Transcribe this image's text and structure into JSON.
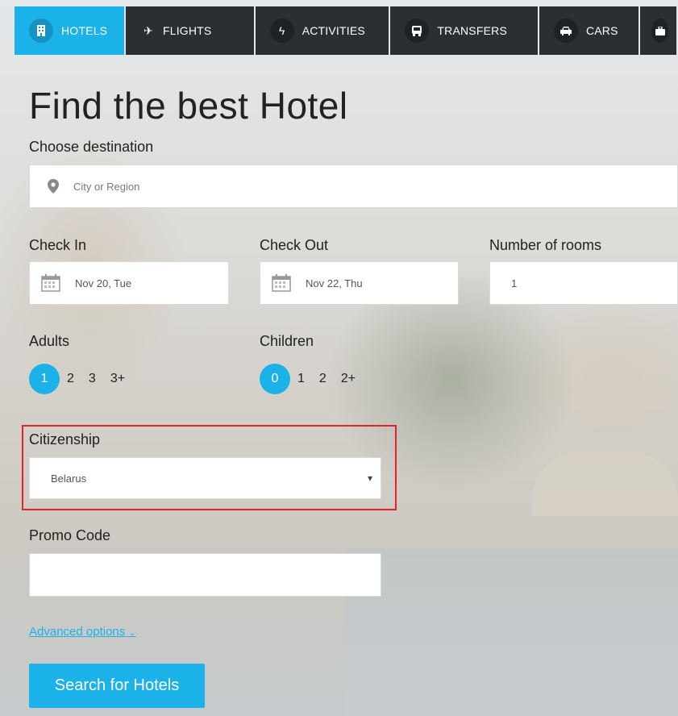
{
  "tabs": [
    {
      "label": "HOTELS",
      "icon": "hotel-icon"
    },
    {
      "label": "FLIGHTS",
      "icon": "plane-icon"
    },
    {
      "label": "ACTIVITIES",
      "icon": "bolt-icon"
    },
    {
      "label": "TRANSFERS",
      "icon": "bus-icon"
    },
    {
      "label": "CARS",
      "icon": "car-icon"
    },
    {
      "label": "",
      "icon": "briefcase-icon"
    }
  ],
  "page": {
    "title": "Find the best Hotel"
  },
  "destination": {
    "label": "Choose destination",
    "placeholder": "City or Region",
    "value": ""
  },
  "check_in": {
    "label": "Check In",
    "value": "Nov 20, Tue"
  },
  "check_out": {
    "label": "Check Out",
    "value": "Nov 22, Thu"
  },
  "rooms": {
    "label": "Number of rooms",
    "value": "1"
  },
  "adults": {
    "label": "Adults",
    "options": [
      "1",
      "2",
      "3",
      "3+"
    ],
    "selected": "1"
  },
  "children": {
    "label": "Children",
    "options": [
      "0",
      "1",
      "2",
      "2+"
    ],
    "selected": "0"
  },
  "citizenship": {
    "label": "Citizenship",
    "value": "Belarus",
    "arrow": "▾"
  },
  "promo": {
    "label": "Promo Code",
    "value": ""
  },
  "advanced": {
    "label": "Advanced options",
    "chevron": "⌄"
  },
  "search_button": {
    "label": "Search for Hotels"
  },
  "colors": {
    "accent": "#1ab2e8",
    "tab_dark": "#2b2f33",
    "highlight": "#e4222a"
  }
}
